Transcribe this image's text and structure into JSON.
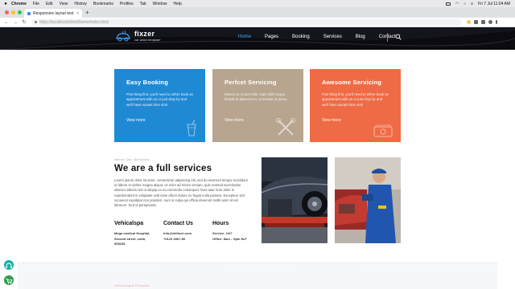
{
  "menubar": {
    "items": [
      "Chrome",
      "File",
      "Edit",
      "View",
      "History",
      "Bookmarks",
      "Profiles",
      "Tab",
      "Window",
      "Help"
    ],
    "datetime": "Fri 7 Jul  11:04 AM"
  },
  "browser": {
    "tab_title": "Responsive layout test",
    "new_tab": "+",
    "tab_close": "×",
    "url": "https://localhost/sites/theme/index.html"
  },
  "site": {
    "logo_name": "fixzer",
    "logo_tagline": "car wash template",
    "nav": [
      "Home",
      "Pages",
      "Booking",
      "Services",
      "Blog",
      "Contact"
    ],
    "active_nav": "Home"
  },
  "cards": [
    {
      "title": "Easy Booking",
      "text": "First thing first, you'll need to either book an appointment with us or just drop by and we'll have vacant time slot!",
      "more": "View more",
      "color": "#2089d4",
      "icon": "drink-icon"
    },
    {
      "title": "Perfcet Servicing",
      "text": "Mauris ac ornare felis. Nam nibh neque, blandit at placerat eu, venenatis et purus.",
      "more": "View more",
      "color": "#b8a58f",
      "icon": "tools-icon"
    },
    {
      "title": "Awesome Servicing",
      "text": "First thing first, you'll need to either book an appointment with us or just drop by and we'll have vacant time slot!",
      "more": "View more",
      "color": "#ef6b45",
      "icon": "money-icon"
    }
  ],
  "services": {
    "kicker": "About Our Services",
    "title": "We are a full services",
    "body": "Lorem ipsum dolor sit amet, consectetur adipiscing elit, sed do eiusmod tempor incididunt ut labore et dolore magna aliqua. Ut enim ad minim veniam, quis nostrud exercitation ullamco laboris nisi ut aliquip ex ea commodo consequat. Duis aute irure dolor in reprehenderit in voluptate velit esse cillum dolore eu fugiat nulla pariatur. Excepteur sint occaecat cupidatat non proident, sunt in culpa qui officia deserunt mollit anim id est laborum. Sed ut perspiciatis.",
    "info": [
      {
        "heading": "Vehicalspa",
        "lines": [
          "Mega medical Hospital,",
          "Second street, cotin,",
          "065235"
        ]
      },
      {
        "heading": "Contact Us",
        "lines": [
          "info@drlitsch.com",
          "+0123 4567-89"
        ]
      },
      {
        "heading": "Hours",
        "lines": [
          "Service: 24/7",
          "Office: 8am – 5pm M-F"
        ]
      }
    ]
  },
  "process": {
    "kicker": "Vehicalspa Process"
  }
}
